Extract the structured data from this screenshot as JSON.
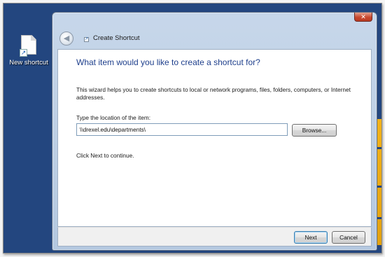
{
  "desktop": {
    "icons": [
      {
        "label": "New shortcut",
        "icon": "shortcut-file-icon"
      }
    ]
  },
  "window": {
    "title": "Create Shortcut",
    "close_glyph": "✕",
    "back_glyph": "◀",
    "heading": "What item would you like to create a shortcut for?",
    "description": "This wizard helps you to create shortcuts to local or network programs, files, folders, computers, or Internet addresses.",
    "location_label": "Type the location of the item:",
    "location_value": "\\\\drexel.edu\\departments\\",
    "browse_label": "Browse...",
    "continue_text": "Click Next to continue.",
    "next_label": "Next",
    "cancel_label": "Cancel"
  },
  "colors": {
    "desktop_bg": "#23467f",
    "accent": "#f2b21a",
    "heading": "#1e3f8c",
    "close_button": "#c8482f"
  }
}
